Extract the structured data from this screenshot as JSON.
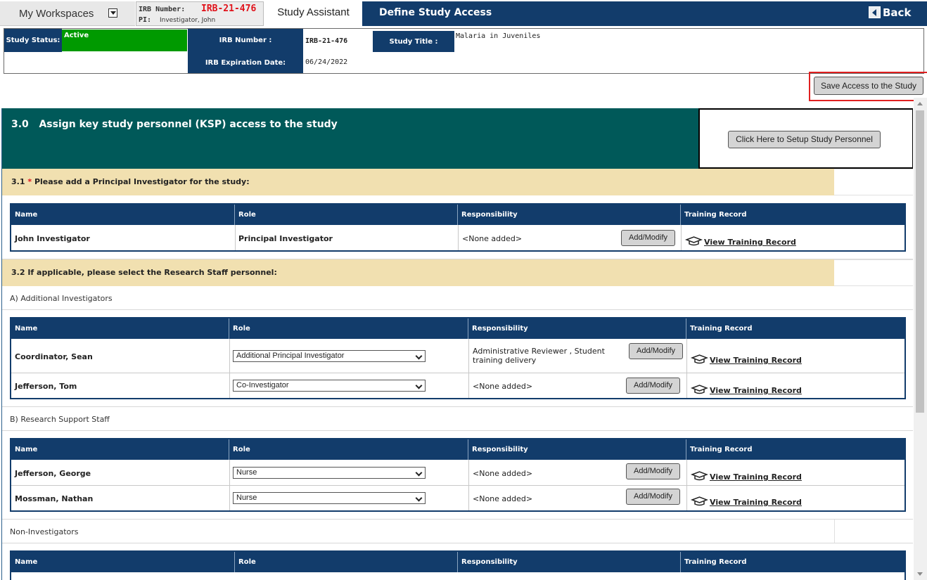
{
  "header": {
    "workspaces_label": "My Workspaces",
    "irb_number_label": "IRB Number:",
    "irb_number_value": "IRB-21-476",
    "pi_label": "PI:",
    "pi_value": "Investigator, John",
    "tab_study_assistant": "Study Assistant",
    "page_title": "Define Study Access",
    "back_label": "Back"
  },
  "status": {
    "status_label": "Study Status:",
    "status_value": "Active",
    "status_color": "#009a00",
    "irb_label": "IRB Number :",
    "irb_value": "IRB-21-476",
    "exp_label": "IRB Expiration Date:",
    "exp_value": "06/24/2022",
    "title_label": "Study Title :",
    "title_value": "Malaria in Juveniles"
  },
  "save_button": "Save Access to the Study",
  "ksp": {
    "number": "3.0",
    "title": "Assign key study personnel (KSP) access to the study",
    "setup_button": "Click Here to Setup Study Personnel"
  },
  "section_pi": {
    "number": "3.1",
    "required_mark": "*",
    "title": "Please add a Principal Investigator for the study:"
  },
  "section_staff": {
    "title": "3.2 If applicable, please select the Research Staff personnel:"
  },
  "columns": {
    "name": "Name",
    "role": "Role",
    "responsibility": "Responsibility",
    "training": "Training Record"
  },
  "labels": {
    "add_modify": "Add/Modify",
    "view_training": "View Training Record"
  },
  "pi_table": {
    "rows": [
      {
        "name": "John Investigator",
        "role": "Principal Investigator",
        "responsibility": "<None added>"
      }
    ]
  },
  "additional_investigators": {
    "label": "A) Additional Investigators",
    "rows": [
      {
        "name": "Coordinator, Sean",
        "role": "Additional Principal Investigator",
        "responsibility": "Administrative Reviewer , Student training delivery"
      },
      {
        "name": "Jefferson, Tom",
        "role": "Co-Investigator",
        "responsibility": "<None added>"
      }
    ]
  },
  "research_support": {
    "label": "B) Research Support Staff",
    "rows": [
      {
        "name": "Jefferson, George",
        "role": "Nurse",
        "responsibility": "<None added>"
      },
      {
        "name": "Mossman, Nathan",
        "role": "Nurse",
        "responsibility": "<None added>"
      }
    ]
  },
  "non_investigators": {
    "label": "Non-Investigators"
  }
}
